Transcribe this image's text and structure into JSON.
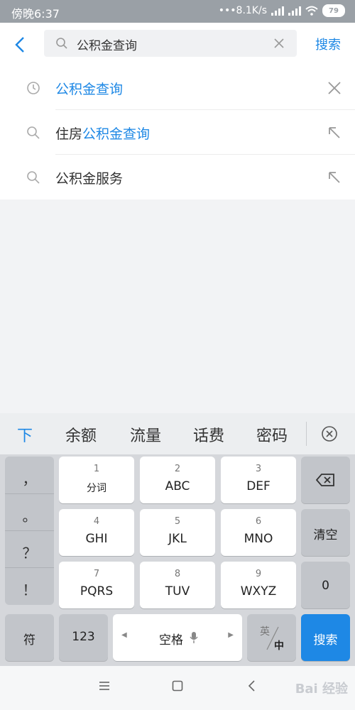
{
  "status": {
    "time": "傍晚6:37",
    "speed": "8.1K/s",
    "battery": "79"
  },
  "header": {
    "query": "公积金查询",
    "search_label": "搜索"
  },
  "suggestions": [
    {
      "plain": "",
      "highlight": "公积金查询",
      "icon": "clock-icon",
      "action": "close-icon"
    },
    {
      "plain": "住房",
      "highlight": "公积金查询",
      "icon": "search-icon",
      "action": "fill-arrow-icon"
    },
    {
      "plain": "公积金服务",
      "highlight": "",
      "icon": "search-icon",
      "action": "fill-arrow-icon"
    }
  ],
  "keyboard": {
    "candidates": [
      "下",
      "余额",
      "流量",
      "话费",
      "密码"
    ],
    "punct": [
      "，",
      "。",
      "？",
      "！"
    ],
    "keys": [
      {
        "n": "1",
        "l": "分词"
      },
      {
        "n": "2",
        "l": "ABC"
      },
      {
        "n": "3",
        "l": "DEF"
      },
      {
        "n": "4",
        "l": "GHI"
      },
      {
        "n": "5",
        "l": "JKL"
      },
      {
        "n": "6",
        "l": "MNO"
      },
      {
        "n": "7",
        "l": "PQRS"
      },
      {
        "n": "8",
        "l": "TUV"
      },
      {
        "n": "9",
        "l": "WXYZ"
      }
    ],
    "clear": "清空",
    "zero": "0",
    "fu": "符",
    "num": "123",
    "space": "空格",
    "lang_en": "英",
    "lang_zh": "中",
    "search": "搜索"
  },
  "watermark": "Bai 经验"
}
